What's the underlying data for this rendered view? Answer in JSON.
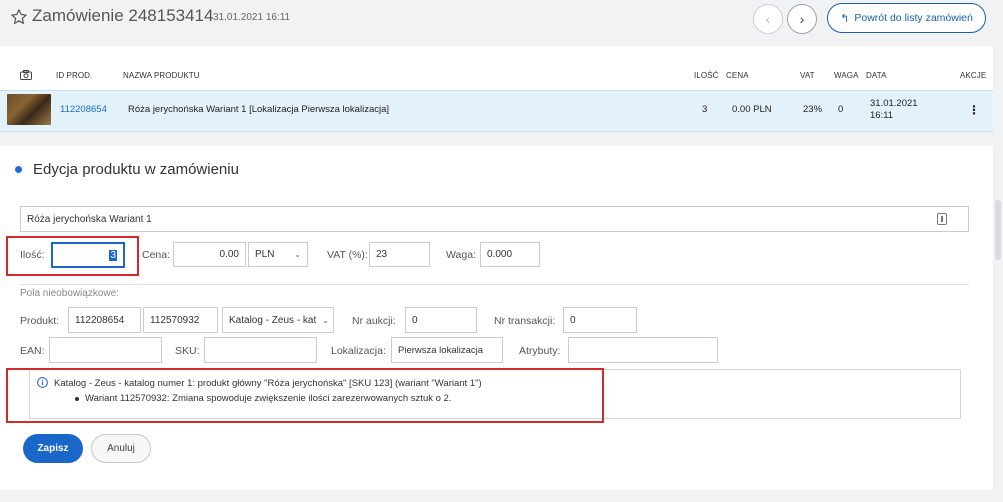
{
  "header": {
    "title": "Zamówienie 248153414",
    "date": "31.01.2021 16:11",
    "back_button": "Powrót do listy zamówień"
  },
  "table": {
    "headers": {
      "id": "ID PROD.",
      "name": "NAZWA PRODUKTU",
      "qty": "ILOŚĆ",
      "price": "CENA",
      "vat": "VAT",
      "weight": "WAGA",
      "date": "DATA",
      "actions": "AKCJE"
    },
    "row": {
      "id": "112208654",
      "name": "Róża jerychońska Wariant 1 [Lokalizacja Pierwsza lokalizacja]",
      "qty": "3",
      "price": "0.00 PLN",
      "vat": "23%",
      "weight": "0",
      "date_line1": "31.01.2021",
      "date_line2": "16:11",
      "actions": "⋮"
    }
  },
  "edit": {
    "title": "Edycja produktu w zamówieniu",
    "product_name": "Róża jerychońska Wariant 1",
    "qty_label": "Ilość:",
    "qty_value": "3",
    "price_label": "Cena:",
    "price_value": "0.00",
    "currency": "PLN",
    "vat_label": "VAT (%):",
    "vat_value": "23",
    "weight_label": "Waga:",
    "weight_value": "0.000",
    "optional_label": "Pola nieobowiązkowe:",
    "product_label": "Produkt:",
    "product_id": "112208654",
    "variant_id": "112570932",
    "catalog": "Katalog - Zeus - kat",
    "auction_label": "Nr aukcji:",
    "auction_value": "0",
    "transaction_label": "Nr transakcji:",
    "transaction_value": "0",
    "ean_label": "EAN:",
    "ean_value": "",
    "sku_label": "SKU:",
    "sku_value": "",
    "location_label": "Lokalizacja:",
    "location_value": "Pierwsza lokalizacja",
    "attributes_label": "Atrybuty:",
    "attributes_value": "",
    "info_line1": "Katalog - Zeus - katalog numer 1: produkt główny \"Róża jerychońska\" [SKU 123] (wariant \"Wariant 1\")",
    "info_line2": "Wariant 112570932: Zmiana spowoduje zwiększenie ilości zarezerwowanych sztuk o 2.",
    "save_button": "Zapisz",
    "cancel_button": "Anuluj"
  },
  "colors": {
    "primary": "#1b67c9",
    "highlight_row": "#e3f1fb",
    "annotation_red": "#d12b2b"
  }
}
